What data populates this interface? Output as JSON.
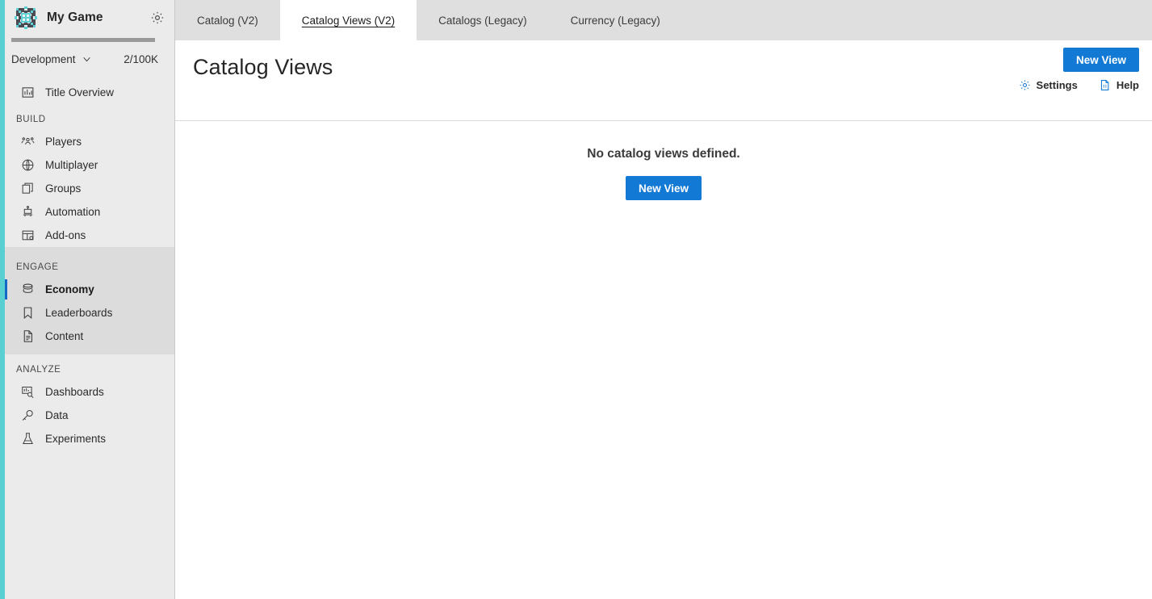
{
  "sidebar": {
    "brand": {
      "title": "My Game",
      "logo_icon": "game-logo-icon",
      "settings_icon": "gear-icon",
      "accent_color": "#58cfd1"
    },
    "environment": {
      "name": "Development",
      "chevron_icon": "chevron-down-icon",
      "quota": "2/100K"
    },
    "top_items": [
      {
        "label": "Title Overview",
        "icon": "bar-chart-icon"
      }
    ],
    "sections": [
      {
        "label": "BUILD",
        "highlight": false,
        "items": [
          {
            "label": "Players",
            "icon": "players-icon",
            "active": false
          },
          {
            "label": "Multiplayer",
            "icon": "globe-icon",
            "active": false
          },
          {
            "label": "Groups",
            "icon": "groups-icon",
            "active": false
          },
          {
            "label": "Automation",
            "icon": "robot-icon",
            "active": false
          },
          {
            "label": "Add-ons",
            "icon": "addons-icon",
            "active": false
          }
        ]
      },
      {
        "label": "ENGAGE",
        "highlight": true,
        "items": [
          {
            "label": "Economy",
            "icon": "economy-icon",
            "active": true
          },
          {
            "label": "Leaderboards",
            "icon": "bookmark-icon",
            "active": false
          },
          {
            "label": "Content",
            "icon": "document-icon",
            "active": false
          }
        ]
      },
      {
        "label": "ANALYZE",
        "highlight": false,
        "items": [
          {
            "label": "Dashboards",
            "icon": "dashboard-search-icon",
            "active": false
          },
          {
            "label": "Data",
            "icon": "data-key-icon",
            "active": false
          },
          {
            "label": "Experiments",
            "icon": "beaker-icon",
            "active": false
          }
        ]
      }
    ]
  },
  "tabs": [
    {
      "label": "Catalog (V2)",
      "active": false
    },
    {
      "label": "Catalog Views (V2)",
      "active": true
    },
    {
      "label": "Catalogs (Legacy)",
      "active": false
    },
    {
      "label": "Currency (Legacy)",
      "active": false
    }
  ],
  "header": {
    "title": "Catalog Views",
    "new_view_label": "New View",
    "settings_label": "Settings",
    "settings_icon": "gear-icon",
    "help_label": "Help",
    "help_icon": "help-document-icon",
    "primary_color": "#1279d4"
  },
  "content": {
    "empty_message": "No catalog views defined.",
    "new_view_label": "New View"
  }
}
